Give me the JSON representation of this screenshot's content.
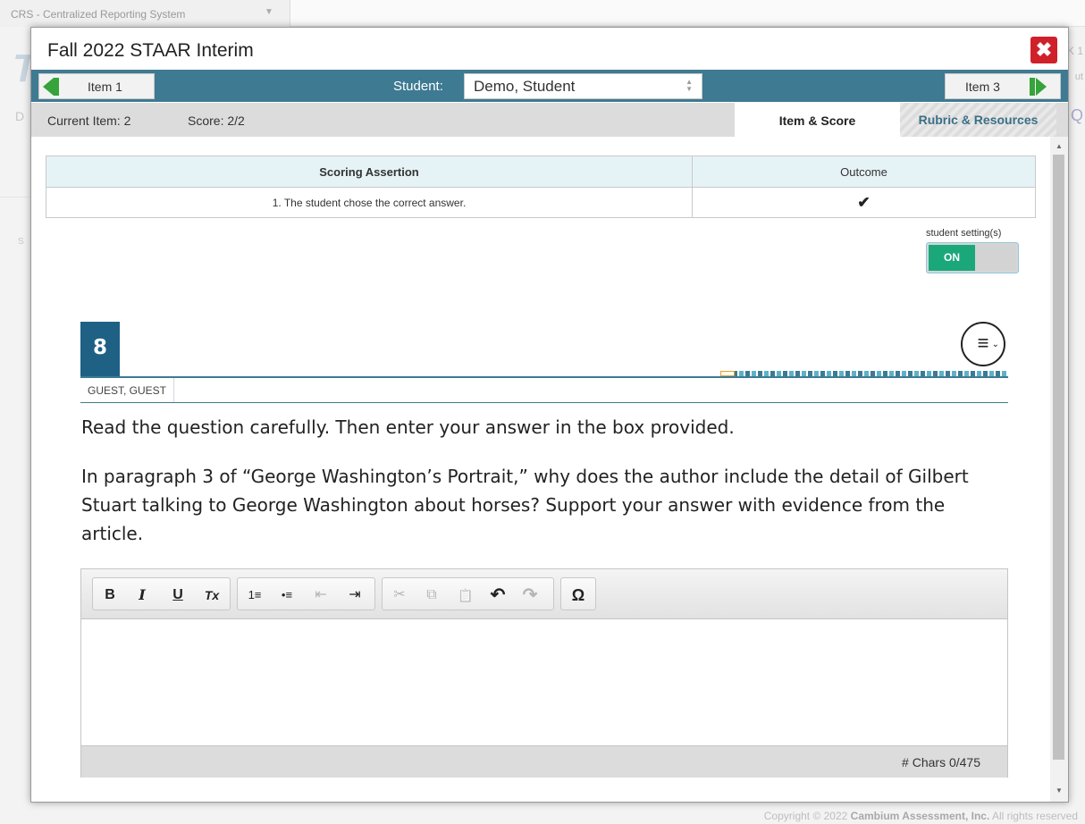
{
  "background": {
    "tab_title": "CRS - Centralized Reporting System",
    "copyright": "Copyright © 2022 Cambium Assessment, Inc. All rights reserved",
    "copyright_prefix": "Copyright © 2022 ",
    "copyright_company": "Cambium Assessment, Inc.",
    "copyright_suffix": " All rights reserved"
  },
  "modal": {
    "title": "Fall 2022 STAAR Interim",
    "close_symbol": "✖"
  },
  "nav": {
    "prev_label": "Item 1",
    "next_label": "Item 3",
    "student_label": "Student:",
    "student_value": "Demo, Student"
  },
  "info": {
    "current_item": "Current Item: 2",
    "score": "Score: 2/2",
    "tabs": [
      {
        "label": "Item & Score",
        "active": true
      },
      {
        "label": "Rubric & Resources",
        "active": false
      }
    ]
  },
  "scoring_table": {
    "headers": [
      "Scoring Assertion",
      "Outcome"
    ],
    "rows": [
      {
        "assertion": "1. The student chose the correct answer.",
        "outcome": "✔"
      }
    ]
  },
  "student_settings": {
    "label": "student setting(s)",
    "state": "ON"
  },
  "question": {
    "number": "8",
    "student_name": "GUEST, GUEST",
    "instruction": "Read the question carefully. Then enter your answer in the box provided.",
    "prompt": "In paragraph 3 of “George Washington’s Portrait,” why does the author include the detail of Gilbert Stuart talking to George Washington about horses? Support your answer with evidence from the article."
  },
  "editor": {
    "toolbar": {
      "bold": "B",
      "italic": "I",
      "underline": "U",
      "clear_format": "Tx",
      "numbered_list": "1≡",
      "bulleted_list": "•≡",
      "outdent": "⇤",
      "indent": "⇥",
      "cut": "✂",
      "copy": "⧉",
      "paste": "📋",
      "undo": "↶",
      "redo": "↷",
      "special_char": "Ω"
    },
    "char_count": "# Chars 0/475"
  }
}
